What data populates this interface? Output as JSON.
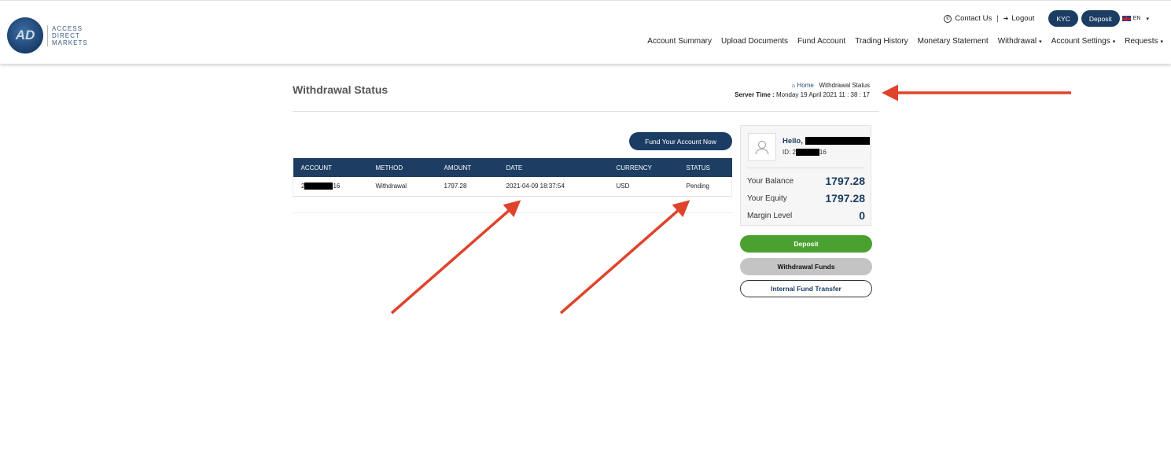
{
  "brand": {
    "logo_text": [
      "ACCESS",
      "DIRECT",
      "MARKETS"
    ],
    "logo_mark": "AD"
  },
  "topbar": {
    "contact": "Contact Us",
    "separator": "|",
    "logout": "Logout",
    "kyc": "KYC",
    "deposit": "Deposit",
    "lang": "EN"
  },
  "nav": [
    {
      "label": "Account Summary"
    },
    {
      "label": "Upload Documents"
    },
    {
      "label": "Fund Account"
    },
    {
      "label": "Trading History"
    },
    {
      "label": "Monetary Statement"
    },
    {
      "label": "Withdrawal",
      "dropdown": true
    },
    {
      "label": "Account Settings",
      "dropdown": true
    },
    {
      "label": "Requests",
      "dropdown": true
    }
  ],
  "page": {
    "title": "Withdrawal Status",
    "breadcrumb_home": "Home",
    "breadcrumb_current": "Withdrawal Status",
    "server_time_label": "Server Time :",
    "server_time": "Monday 19 April 2021 11 : 38 : 17"
  },
  "fund_button": "Fund Your Account Now",
  "table": {
    "headers": [
      "ACCOUNT",
      "METHOD",
      "AMOUNT",
      "DATE",
      "CURRENCY",
      "STATUS"
    ],
    "rows": [
      {
        "account_prefix": "2",
        "account_suffix": "16",
        "method": "Withdrawal",
        "amount": "1797.28",
        "date": "2021-04-09 18:37:54",
        "currency": "USD",
        "status": "Pending"
      }
    ]
  },
  "profile": {
    "hello": "Hello,",
    "id_prefix": "ID: 2",
    "id_suffix": "16",
    "balance_label": "Your Balance",
    "balance": "1797.28",
    "equity_label": "Your Equity",
    "equity": "1797.28",
    "margin_label": "Margin Level",
    "margin": "0"
  },
  "actions": {
    "deposit": "Deposit",
    "withdrawal": "Withdrawal Funds",
    "transfer": "Internal Fund Transfer"
  },
  "colors": {
    "navy": "#1c3d63",
    "green": "#4aa12f",
    "grey": "#c4c4c4",
    "annotation_arrow": "#e0432b"
  }
}
